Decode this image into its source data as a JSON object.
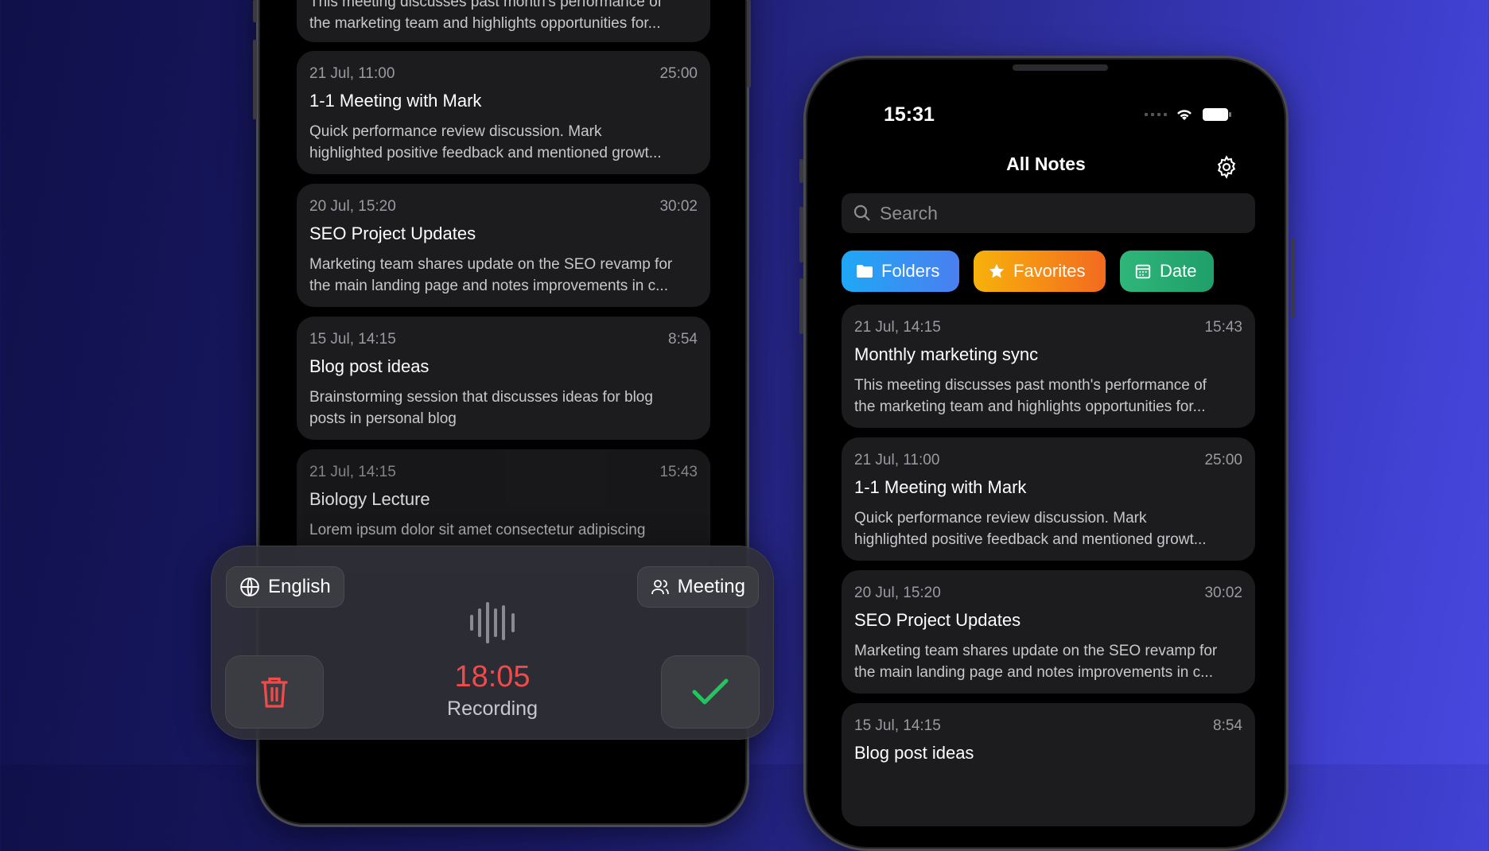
{
  "left_phone": {
    "notes": [
      {
        "date": "",
        "duration": "",
        "title": "",
        "desc": [
          "This meeting discusses past month's performance of",
          "the marketing team and highlights opportunities for..."
        ]
      },
      {
        "date": "21 Jul, 11:00",
        "duration": "25:00",
        "title": "1-1 Meeting with Mark",
        "desc": [
          "Quick performance review discussion. Mark",
          "highlighted positive feedback and mentioned growt..."
        ]
      },
      {
        "date": "20 Jul, 15:20",
        "duration": "30:02",
        "title": "SEO Project Updates",
        "desc": [
          "Marketing team shares update on the SEO revamp for",
          "the main landing page and notes improvements in c..."
        ]
      },
      {
        "date": "15 Jul, 14:15",
        "duration": "8:54",
        "title": "Blog post ideas",
        "desc": [
          "Brainstorming session that discusses ideas for blog",
          "posts in personal blog"
        ]
      },
      {
        "date": "21 Jul, 14:15",
        "duration": "15:43",
        "title": "Biology Lecture",
        "desc": [
          "Lorem ipsum dolor sit amet consectetur adipiscing",
          ""
        ]
      }
    ]
  },
  "recorder": {
    "language_label": "English",
    "mode_label": "Meeting",
    "timer": "18:05",
    "status": "Recording",
    "accent_red": "#ef4b4b",
    "accent_green": "#22c55e"
  },
  "right_phone": {
    "status_time": "15:31",
    "nav_title": "All Notes",
    "search_placeholder": "Search",
    "chips": [
      {
        "label": "Folders",
        "icon": "folder-icon",
        "color": "#2f8ef0"
      },
      {
        "label": "Favorites",
        "icon": "star-icon",
        "color": "#f59a0b"
      },
      {
        "label": "Date",
        "icon": "calendar-icon",
        "color": "#2fb67a"
      }
    ],
    "notes": [
      {
        "date": "21 Jul, 14:15",
        "duration": "15:43",
        "title": "Monthly marketing sync",
        "desc": [
          "This meeting discusses past month's performance of",
          "the marketing team and highlights opportunities for..."
        ]
      },
      {
        "date": "21 Jul, 11:00",
        "duration": "25:00",
        "title": "1-1 Meeting with Mark",
        "desc": [
          "Quick performance review discussion. Mark",
          "highlighted positive feedback and mentioned growt..."
        ]
      },
      {
        "date": "20 Jul, 15:20",
        "duration": "30:02",
        "title": "SEO Project Updates",
        "desc": [
          "Marketing team shares update on the SEO revamp for",
          "the main landing page and notes improvements in c..."
        ]
      },
      {
        "date": "15 Jul, 14:15",
        "duration": "8:54",
        "title": "Blog post ideas",
        "desc": [
          "",
          ""
        ]
      }
    ]
  }
}
